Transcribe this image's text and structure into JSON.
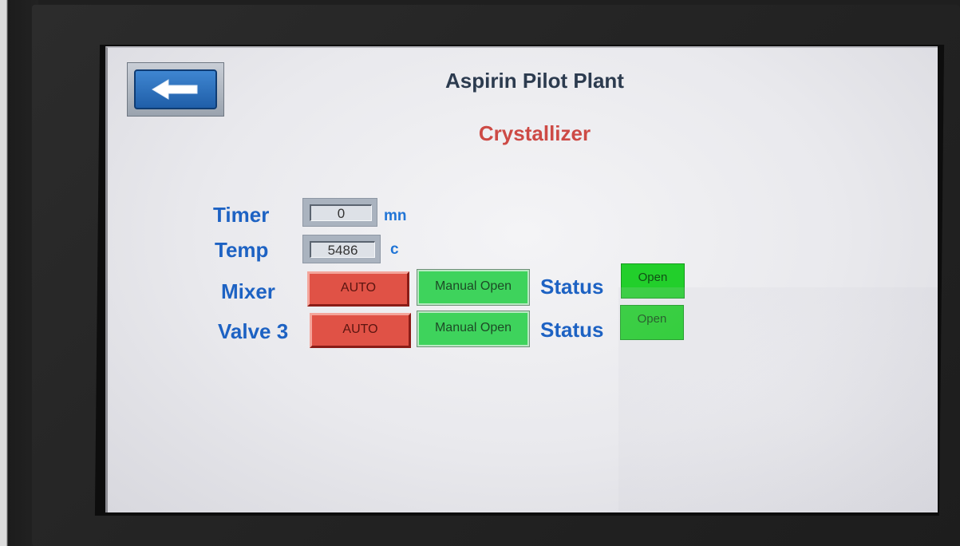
{
  "header": {
    "title": "Aspirin Pilot Plant",
    "subtitle": "Crystallizer"
  },
  "back_button": {
    "icon": "arrow-left-icon"
  },
  "timer": {
    "label": "Timer",
    "value": "0",
    "unit": "mn"
  },
  "temp": {
    "label": "Temp",
    "value": "5486",
    "unit": "c"
  },
  "mixer": {
    "label": "Mixer",
    "auto_label": "AUTO",
    "manual_label": "Manual Open",
    "status_label": "Status",
    "status_value": "Open"
  },
  "valve3": {
    "label": "Valve 3",
    "auto_label": "AUTO",
    "manual_label": "Manual Open",
    "status_label": "Status",
    "status_value": "Open"
  },
  "colors": {
    "title": "#2c3b4f",
    "subtitle": "#cd4a45",
    "label": "#1d62c3",
    "auto_button": "#e05246",
    "manual_button": "#3ed35c",
    "status_open": "#22cf2b"
  }
}
